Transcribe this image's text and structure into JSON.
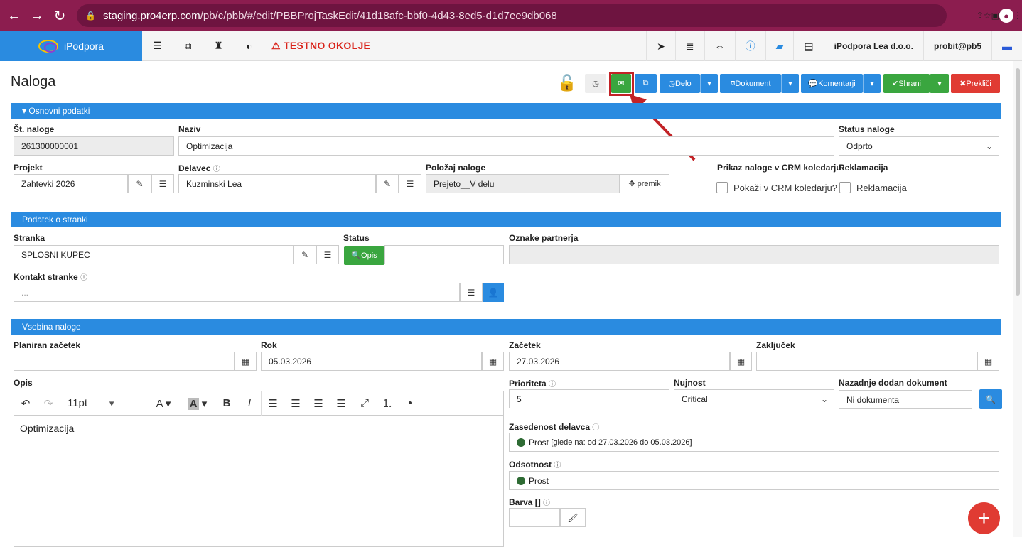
{
  "browser": {
    "url_host": "staging.pro4erp.com",
    "url_path": "/pb/c/pbb/#/edit/PBBProjTaskEdit/41d18afc-bbf0-4d43-8ed5-d1d7ee9db068"
  },
  "topbar": {
    "brand": "iPodpora",
    "env_label": "TESTNO OKOLJE",
    "company": "iPodpora Lea d.o.o.",
    "user": "probit@pb5"
  },
  "page": {
    "title": "Naloga"
  },
  "toolbar": {
    "delo": "Delo",
    "dokument": "Dokument",
    "komentarji": "Komentarji",
    "shrani": "Shrani",
    "preklici": "Prekliči"
  },
  "sec1": {
    "title": "Osnovni podatki",
    "st_label": "Št. naloge",
    "st_value": "261300000001",
    "naziv_label": "Naziv",
    "naziv_value": "Optimizacija",
    "status_label": "Status naloge",
    "status_value": "Odprto",
    "projekt_label": "Projekt",
    "projekt_value": "Zahtevki 2026",
    "delavec_label": "Delavec",
    "delavec_value": "Kuzminski Lea",
    "polozaj_label": "Položaj naloge",
    "polozaj_value": "Prejeto__V delu",
    "premik": "premik",
    "crm_label": "Prikaz naloge v CRM koledarju",
    "crm_check": "Pokaži v CRM koledarju?",
    "rekl_label": "Reklamacija",
    "rekl_check": "Reklamacija"
  },
  "sec2": {
    "title": "Podatek o stranki",
    "stranka_label": "Stranka",
    "stranka_value": "SPLOSNI KUPEC",
    "status_label": "Status",
    "opis_btn": "Opis",
    "oznake_label": "Oznake partnerja",
    "kontakt_label": "Kontakt stranke",
    "kontakt_value": "..."
  },
  "sec3": {
    "title": "Vsebina naloge",
    "plan_label": "Planiran začetek",
    "rok_label": "Rok",
    "rok_value": "05.03.2026",
    "zacetek_label": "Začetek",
    "zacetek_value": "27.03.2026",
    "zakljucek_label": "Zaključek",
    "opis_label": "Opis",
    "font_size": "11pt",
    "editor_text": "Optimizacija",
    "prioriteta_label": "Prioriteta",
    "prioriteta_value": "5",
    "nujnost_label": "Nujnost",
    "nujnost_value": "Critical",
    "nazadnje_label": "Nazadnje dodan dokument",
    "nazadnje_value": "Ni dokumenta",
    "zased_label": "Zasedenost delavca",
    "zased_value": "Prost",
    "zased_note": "[glede na: od 27.03.2026 do 05.03.2026]",
    "odsot_label": "Odsotnost",
    "odsot_value": "Prost",
    "barva_label": "Barva []"
  },
  "colors": {
    "chrome": "#8c1d4f",
    "accent": "#2a8be0",
    "success": "#3aa63f",
    "danger": "#e03b33",
    "highlight": "#c22226"
  }
}
